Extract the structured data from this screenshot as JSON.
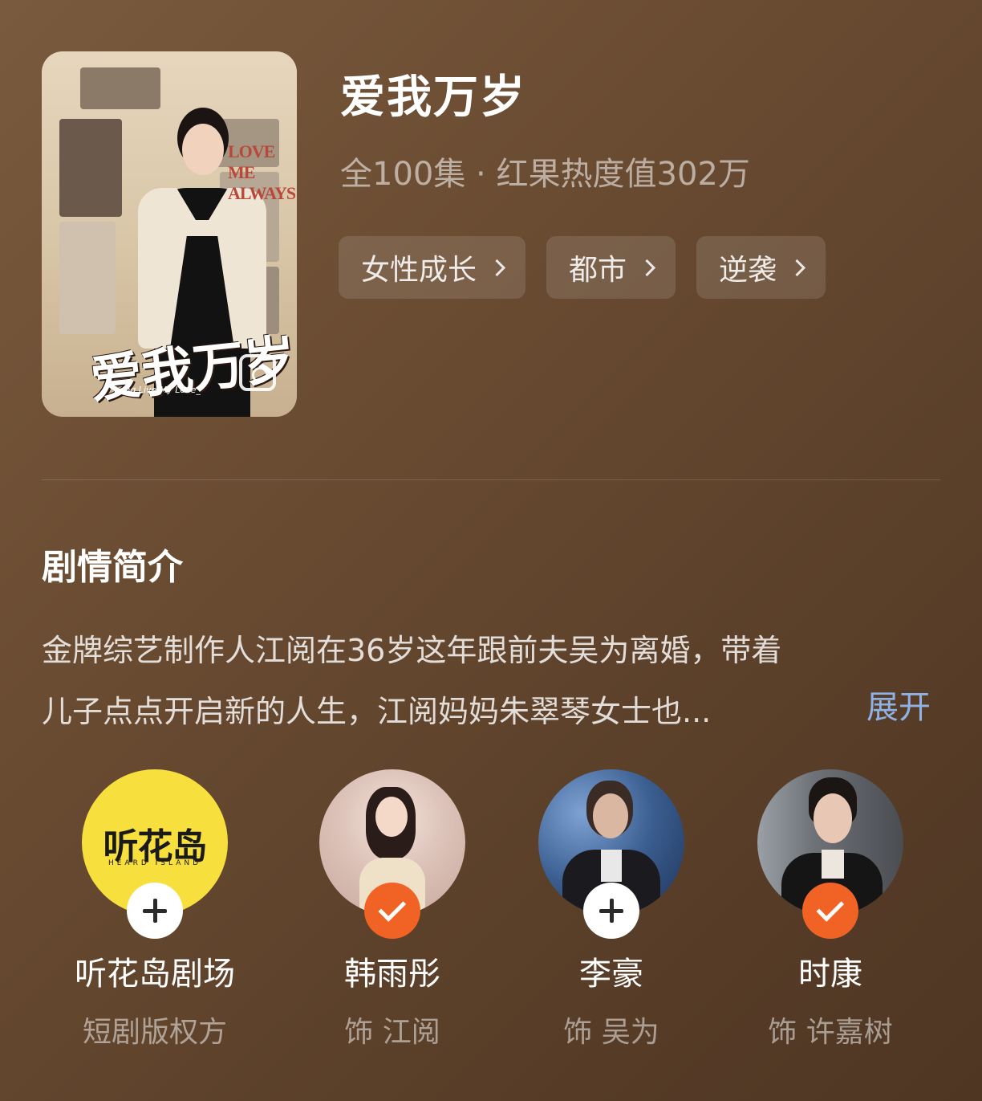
{
  "drama": {
    "title": "爱我万岁",
    "meta": "全100集 · 红果热度值302万",
    "tags": [
      {
        "label": "女性成长"
      },
      {
        "label": "都市"
      },
      {
        "label": "逆袭"
      }
    ],
    "poster": {
      "en_title": "LOVE ME ALWAYS",
      "cn_title": "爱我万岁",
      "sub_title": "_Long Live My Love_"
    }
  },
  "synopsis": {
    "heading": "剧情简介",
    "line1": "金牌综艺制作人江阅在36岁这年跟前夫吴为离婚，带着",
    "line2": "儿子点点开启新的人生，江阅妈妈朱翠琴女士也...",
    "expand_label": "展开"
  },
  "cast": [
    {
      "name": "听花岛剧场",
      "role": "短剧版权方",
      "badge": "plus",
      "logo_text": "听花岛",
      "logo_sub": "HEARD ISLAND",
      "avatar_color": "#f7df3e"
    },
    {
      "name": "韩雨彤",
      "role": "饰 江阅",
      "badge": "check",
      "avatar_color": "#e9d7d0"
    },
    {
      "name": "李豪",
      "role": "饰 吴为",
      "badge": "plus",
      "avatar_color": "#3a5d8f"
    },
    {
      "name": "时康",
      "role": "饰 许嘉树",
      "badge": "check",
      "avatar_color": "#5e6166"
    }
  ],
  "colors": {
    "accent_link": "#8eb2e6",
    "follow_check": "#f06324"
  }
}
